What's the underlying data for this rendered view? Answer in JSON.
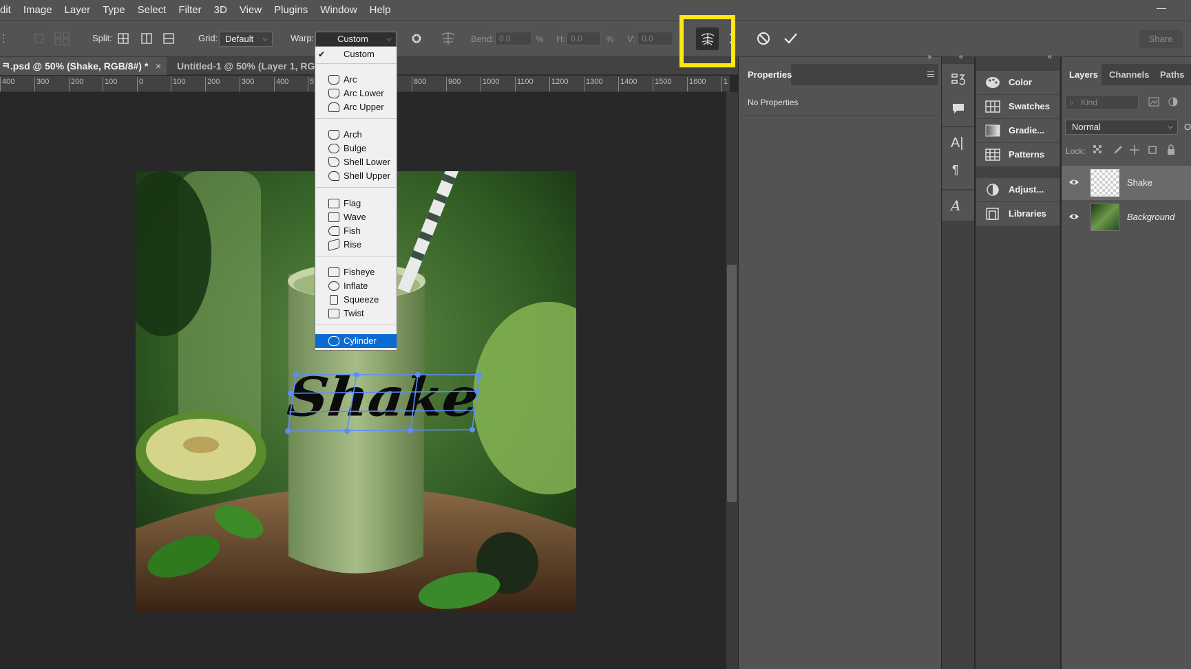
{
  "menubar": {
    "items": [
      "dit",
      "Image",
      "Layer",
      "Type",
      "Select",
      "Filter",
      "3D",
      "View",
      "Plugins",
      "Window",
      "Help"
    ]
  },
  "options": {
    "split_label": "Split:",
    "grid_label": "Grid:",
    "grid_value": "Default",
    "warp_label": "Warp:",
    "warp_value": "Custom",
    "bend_label": "Bend:",
    "bend_value": "0.0",
    "pct": "%",
    "h_label": "H:",
    "h_value": "0.0",
    "v_label": "V:",
    "v_value": "0.0",
    "share_label": "Share",
    "highlight_color": "#ffe711"
  },
  "tabs": [
    {
      "label": "ㅋ.psd @ 50% (Shake, RGB/8#) *",
      "close": "×"
    },
    {
      "label": "Untitled-1 @ 50% (Layer 1, RGB"
    }
  ],
  "ruler": {
    "ticks": [
      "400",
      "300",
      "200",
      "100",
      "0",
      "100",
      "200",
      "300",
      "400",
      "5",
      "800",
      "900",
      "1000",
      "1100",
      "1200",
      "1300",
      "1400",
      "1500",
      "1600",
      "1"
    ]
  },
  "canvas": {
    "text": "Shake"
  },
  "warp_menu": {
    "items": [
      {
        "label": "Custom",
        "checked": true
      },
      {
        "label": "Arc",
        "icon": "arc-icon"
      },
      {
        "label": "Arc Lower",
        "icon": "arc-lower-icon"
      },
      {
        "label": "Arc Upper",
        "icon": "arc-upper-icon"
      },
      {
        "label": "Arch",
        "icon": "arch-icon"
      },
      {
        "label": "Bulge",
        "icon": "bulge-icon"
      },
      {
        "label": "Shell Lower",
        "icon": "shell-lower-icon"
      },
      {
        "label": "Shell Upper",
        "icon": "shell-upper-icon"
      },
      {
        "label": "Flag",
        "icon": "flag-icon"
      },
      {
        "label": "Wave",
        "icon": "wave-icon"
      },
      {
        "label": "Fish",
        "icon": "fish-icon"
      },
      {
        "label": "Rise",
        "icon": "rise-icon"
      },
      {
        "label": "Fisheye",
        "icon": "fisheye-icon"
      },
      {
        "label": "Inflate",
        "icon": "inflate-icon"
      },
      {
        "label": "Squeeze",
        "icon": "squeeze-icon"
      },
      {
        "label": "Twist",
        "icon": "twist-icon"
      },
      {
        "label": "Cylinder",
        "icon": "cylinder-icon",
        "highlighted": true
      }
    ],
    "highlight_color": "#0a6bd3"
  },
  "properties": {
    "tab": "Properties",
    "empty": "No Properties"
  },
  "dock": {
    "items": [
      "Color",
      "Swatches",
      "Gradie...",
      "Patterns",
      "Adjust...",
      "Libraries"
    ]
  },
  "layers": {
    "tabs": [
      "Layers",
      "Channels",
      "Paths"
    ],
    "kind_placeholder": "Kind",
    "blend_mode": "Normal",
    "opacity_initial": "O",
    "lock_label": "Lock:",
    "rows": [
      {
        "name": "Shake",
        "selected": true
      },
      {
        "name": "Background",
        "selected": false
      }
    ]
  }
}
